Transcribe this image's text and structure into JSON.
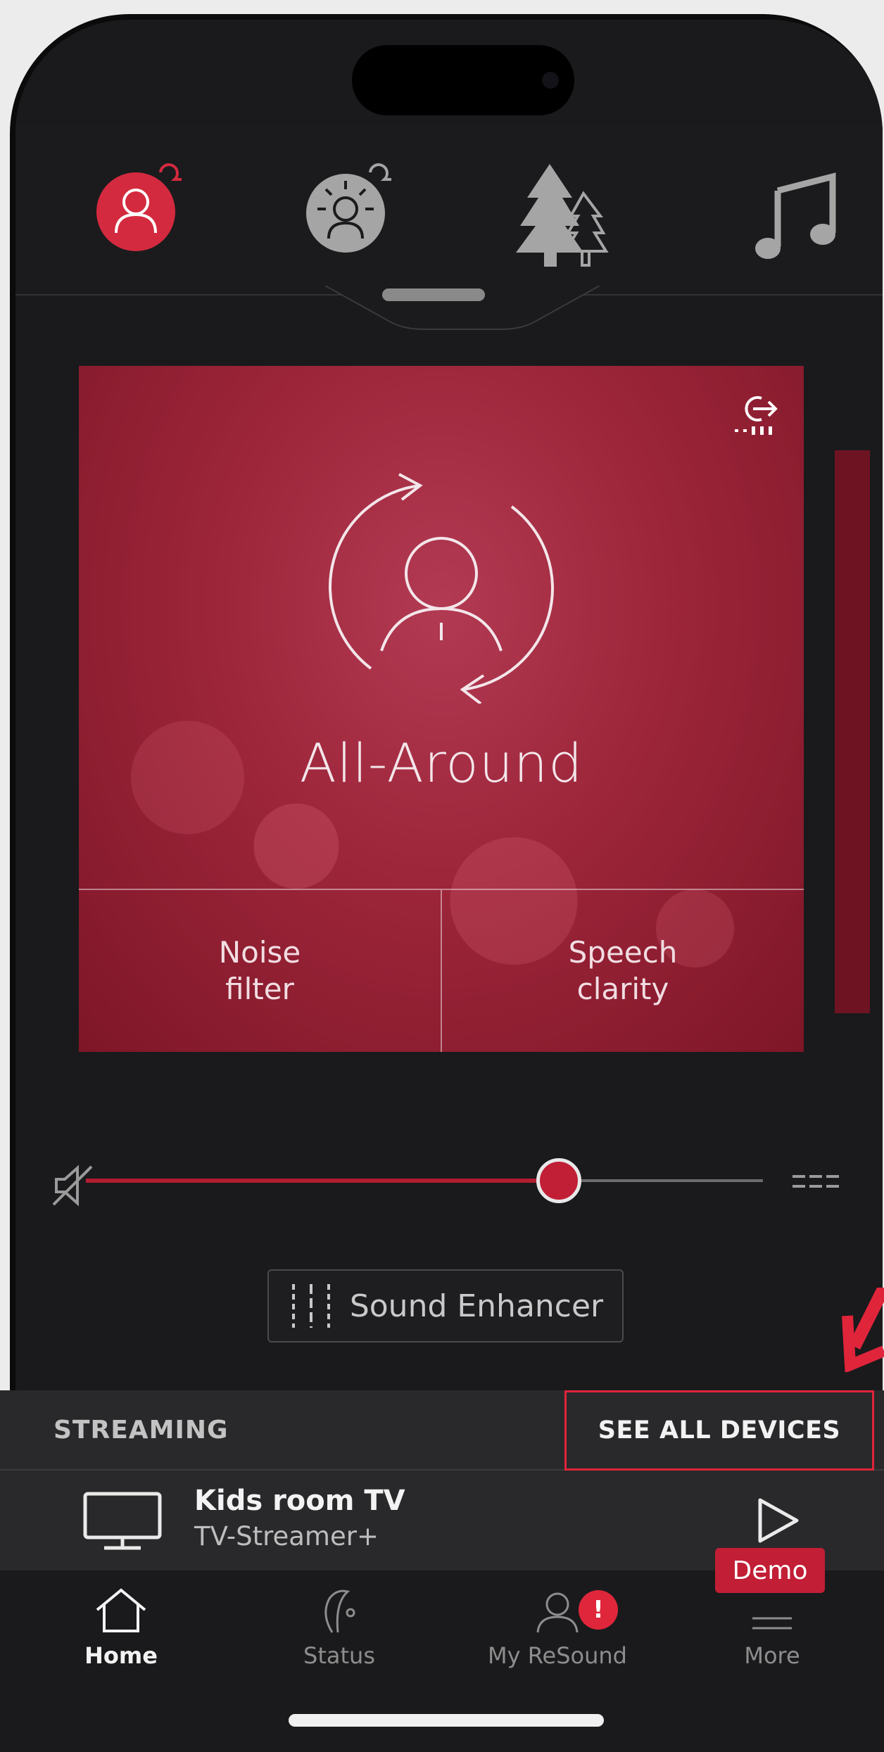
{
  "program": {
    "name": "All-Around",
    "controls": [
      "Noise\nfilter",
      "Speech\nclarity"
    ]
  },
  "programs_bar": [
    {
      "icon": "all-around-program-icon",
      "active": true
    },
    {
      "icon": "restaurant-program-icon",
      "active": false
    },
    {
      "icon": "outdoor-program-icon",
      "active": false
    },
    {
      "icon": "music-program-icon",
      "active": false
    }
  ],
  "volume": {
    "level": 0.68
  },
  "sound_enhancer_label": "Sound Enhancer",
  "streaming": {
    "section_label": "STREAMING",
    "see_all_label": "SEE ALL DEVICES",
    "device_name": "Kids room TV",
    "device_type": "TV-Streamer+"
  },
  "tabs": [
    {
      "label": "Home",
      "icon": "home-icon",
      "active": true
    },
    {
      "label": "Status",
      "icon": "hearing-aid-icon",
      "active": false
    },
    {
      "label": "My ReSound",
      "icon": "profile-icon",
      "active": false,
      "badge": "!"
    },
    {
      "label": "More",
      "icon": "menu-icon",
      "active": false
    }
  ],
  "demo_label": "Demo",
  "colors": {
    "accent": "#c11f36",
    "card": "#9c2539",
    "background": "#1a1a1c"
  }
}
